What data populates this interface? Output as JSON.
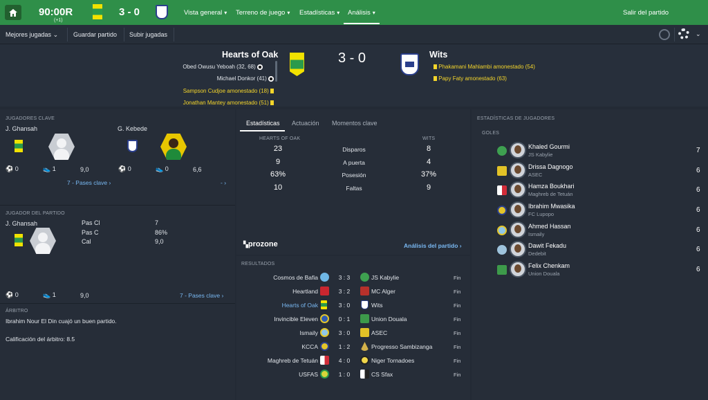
{
  "topbar": {
    "clock": "90:00R",
    "clock_sub": "(+1)",
    "score": "3 - 0",
    "nav": [
      {
        "label": "Vista general"
      },
      {
        "label": "Terreno de juego"
      },
      {
        "label": "Estadísticas"
      },
      {
        "label": "Análisis"
      }
    ],
    "exit_label": "Salir del partido",
    "accent": "#2f8f49"
  },
  "subbar": {
    "dropdown": "Mejores jugadas",
    "save": "Guardar partido",
    "upload": "Subir jugadas"
  },
  "match": {
    "home": "Hearts of Oak",
    "away": "Wits",
    "score": "3 - 0",
    "home_events": [
      {
        "text": "Obed Owusu Yeboah (32, 68)",
        "type": "goal"
      },
      {
        "text": "Michael Donkor (41)",
        "type": "goal"
      },
      {
        "text": "Sampson Cudjoe amonestado (18)",
        "type": "yellow"
      },
      {
        "text": "Jonathan Mantey amonestado (51)",
        "type": "yellow"
      }
    ],
    "away_events": [
      {
        "text": "Phakamani Mahlambi amonestado (54)",
        "type": "yellow"
      },
      {
        "text": "Papy Faty amonestado (63)",
        "type": "yellow"
      }
    ]
  },
  "key_players": {
    "title": "JUGADORES CLAVE",
    "home": {
      "name": "J. Ghansah",
      "goals": "0",
      "assists": "1",
      "rating": "9,0",
      "link": "7 - Pases clave"
    },
    "away": {
      "name": "G. Kebede",
      "goals": "0",
      "assists": "0",
      "rating": "6,6",
      "link": "- "
    }
  },
  "potm": {
    "title": "JUGADOR DEL PARTIDO",
    "name": "J. Ghansah",
    "stats": [
      {
        "label": "Pas Cl",
        "value": "7"
      },
      {
        "label": "Pas C",
        "value": "86%"
      },
      {
        "label": "Cal",
        "value": "9,0"
      }
    ],
    "goals": "0",
    "assists": "1",
    "rating": "9,0",
    "link": "7 - Pases clave"
  },
  "referee": {
    "title": "ÁRBITRO",
    "text": "Ibrahim Nour El Din cuajó un buen partido.",
    "rating": "Calificación del árbitro: 8.5"
  },
  "stats": {
    "tabs": [
      "Estadísticas",
      "Actuación",
      "Momentos clave"
    ],
    "home_label": "HEARTS OF OAK",
    "away_label": "WITS",
    "rows": [
      {
        "home": "23",
        "label": "Disparos",
        "away": "8"
      },
      {
        "home": "9",
        "label": "A puerta",
        "away": "4"
      },
      {
        "home": "63%",
        "label": "Posesión",
        "away": "37%"
      },
      {
        "home": "10",
        "label": "Faltas",
        "away": "9"
      }
    ],
    "brand": "prozone",
    "analysis_link": "Análisis del partido"
  },
  "results": {
    "title": "RESULTADOS",
    "rows": [
      {
        "home": "Cosmos de Bafia",
        "score": "3 : 3",
        "away": "JS Kabylie",
        "status": "Fin"
      },
      {
        "home": "Heartland",
        "score": "3 : 2",
        "away": "MC Alger",
        "status": "Fin"
      },
      {
        "home": "Hearts of Oak",
        "score": "3 : 0",
        "away": "Wits",
        "status": "Fin"
      },
      {
        "home": "Invincible Eleven",
        "score": "0 : 1",
        "away": "Union Douala",
        "status": "Fin"
      },
      {
        "home": "Ismaily",
        "score": "3 : 0",
        "away": "ASEC",
        "status": "Fin"
      },
      {
        "home": "KCCA",
        "score": "1 : 2",
        "away": "Progresso Sambizanga",
        "status": "Fin"
      },
      {
        "home": "Maghreb de Tetuán",
        "score": "4 : 0",
        "away": "Niger Tornadoes",
        "status": "Fin"
      },
      {
        "home": "USFAS",
        "score": "1 : 0",
        "away": "CS Sfax",
        "status": "Fin"
      }
    ]
  },
  "player_stats": {
    "title": "ESTADÍSTICAS DE JUGADORES",
    "subtitle": "GOLES",
    "rows": [
      {
        "name": "Khaled Gourmi",
        "club": "JS Kabylie",
        "goals": "7"
      },
      {
        "name": "Drissa Dagnogo",
        "club": "ASEC",
        "goals": "6"
      },
      {
        "name": "Hamza Boukhari",
        "club": "Maghreb de Tetuán",
        "goals": "6"
      },
      {
        "name": "Ibrahim Mwasika",
        "club": "FC Lupopo",
        "goals": "6"
      },
      {
        "name": "Ahmed Hassan",
        "club": "Ismaily",
        "goals": "6"
      },
      {
        "name": "Dawit Fekadu",
        "club": "Dedebit",
        "goals": "6"
      },
      {
        "name": "Felix Chenkam",
        "club": "Union Douala",
        "goals": "6"
      }
    ]
  }
}
